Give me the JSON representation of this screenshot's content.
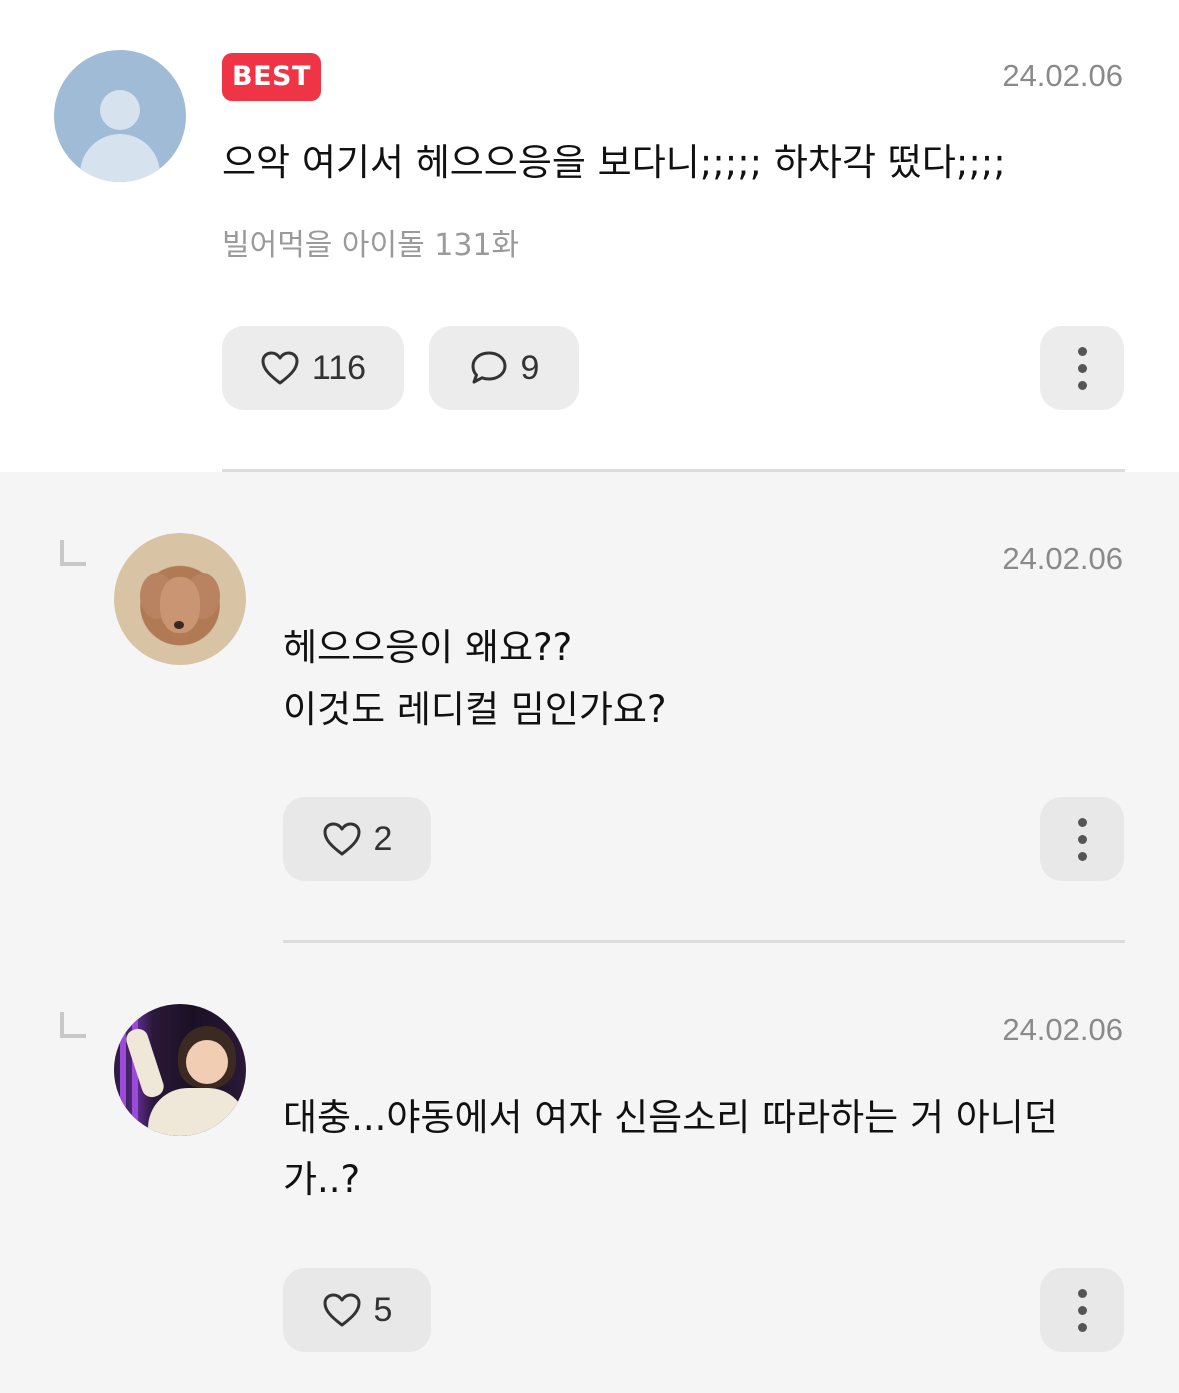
{
  "best_comment": {
    "badge": "BEST",
    "date": "24.02.06",
    "text": "으악 여기서 헤으으응을 보다니;;;;; 하차각 떴다;;;;",
    "episode": "빌어먹을 아이돌 131화",
    "likes": "116",
    "replies": "9",
    "avatar": "default-user-icon"
  },
  "replies": [
    {
      "date": "24.02.06",
      "lines": [
        "헤으으응이 왜요??",
        "이것도 레디컬 밈인가요?"
      ],
      "likes": "2",
      "avatar": "dog-photo"
    },
    {
      "date": "24.02.06",
      "lines": [
        "대충...야동에서 여자 신음소리 따라하는 거 아니던",
        "가..?"
      ],
      "likes": "5",
      "avatar": "girl-photo"
    }
  ],
  "colors": {
    "badge": "#ef3545",
    "date": "#8a8a8a",
    "button_bg": "#ececec",
    "reply_bg": "#f5f5f5",
    "avatar_default": "#9fbbd6"
  },
  "icons": [
    "heart-icon",
    "speech-bubble-icon",
    "more-vertical-icon",
    "reply-arrow-icon"
  ]
}
